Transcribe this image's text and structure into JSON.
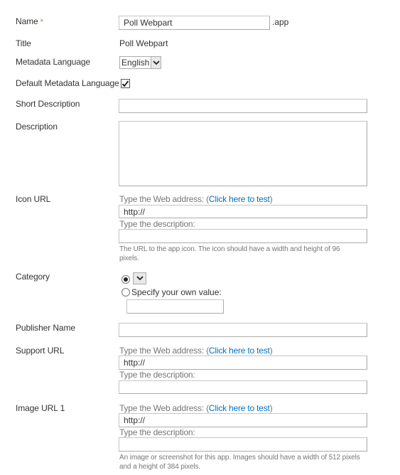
{
  "fields": {
    "name": {
      "label": "Name",
      "required_marker": "*",
      "value": "Poll Webpart",
      "suffix": ".app"
    },
    "title": {
      "label": "Title",
      "value": "Poll Webpart"
    },
    "metadata_language": {
      "label": "Metadata Language",
      "selected": "English"
    },
    "default_metadata_language": {
      "label": "Default Metadata Language",
      "checked": true
    },
    "short_description": {
      "label": "Short Description",
      "value": ""
    },
    "description": {
      "label": "Description",
      "value": ""
    },
    "icon_url": {
      "label": "Icon URL",
      "address_prefix": "Type the Web address: (",
      "test_link": "Click here to test",
      "address_suffix": ")",
      "url_value": "http://",
      "description_label": "Type the description:",
      "description_value": "",
      "note": "The URL to the app icon. The icon should have a width and height of 96 pixels."
    },
    "category": {
      "label": "Category",
      "choice_selected": "",
      "own_value_label": "Specify your own value:",
      "own_value": "",
      "selected_option": "dropdown"
    },
    "publisher_name": {
      "label": "Publisher Name",
      "value": ""
    },
    "support_url": {
      "label": "Support URL",
      "address_prefix": "Type the Web address: (",
      "test_link": "Click here to test",
      "address_suffix": ")",
      "url_value": "http://",
      "description_label": "Type the description:",
      "description_value": ""
    },
    "image_url_1": {
      "label": "Image URL 1",
      "address_prefix": "Type the Web address: (",
      "test_link": "Click here to test",
      "address_suffix": ")",
      "url_value": "http://",
      "description_label": "Type the description:",
      "description_value": "",
      "note": "An image or screenshot for this app. Images should have a width of 512 pixels and a height of 384 pixels."
    }
  },
  "icons": {
    "dropdown": "chevron-down-icon",
    "checkbox": "checkmark-icon",
    "radio": "radio-dot-icon"
  },
  "colors": {
    "link": "#0072c6",
    "required": "#6aa84f",
    "hint": "#777777",
    "text": "#333333"
  }
}
